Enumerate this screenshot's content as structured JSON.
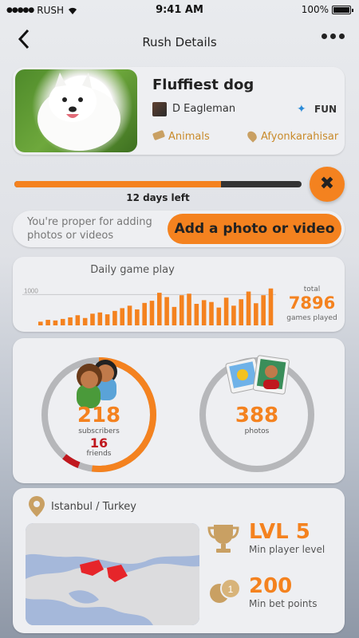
{
  "status_bar": {
    "carrier": "RUSH",
    "time": "9:41 AM",
    "battery": "100%"
  },
  "nav": {
    "title": "Rush Details"
  },
  "rush": {
    "title": "Fluffiest dog",
    "author": "D Eagleman",
    "mood": "FUN",
    "category": "Animals",
    "location": "Afyonkarahisar"
  },
  "progress": {
    "label": "12 days left",
    "fraction": 0.72
  },
  "add_media": {
    "hint": "You're proper for adding photos or videos",
    "button": "Add a photo or video"
  },
  "daily_chart": {
    "title": "Daily game play",
    "total_label": "total",
    "total_value": "7896",
    "total_sub": "games played"
  },
  "chart_data": {
    "type": "bar",
    "title": "Daily game play",
    "ytick": "1000",
    "ylim": [
      0,
      1400
    ],
    "values": [
      120,
      180,
      160,
      210,
      260,
      330,
      240,
      380,
      420,
      360,
      470,
      560,
      640,
      520,
      730,
      800,
      1060,
      920,
      600,
      980,
      1030,
      700,
      820,
      760,
      580,
      900,
      640,
      850,
      1100,
      720,
      980,
      1200
    ]
  },
  "stats": {
    "subscribers_value": "218",
    "subscribers_label": "subscribers",
    "friends_value": "16",
    "friends_label": "friends",
    "subscribers_fraction": 0.52,
    "friends_fraction": 0.05,
    "photos_value": "388",
    "photos_label": "photos"
  },
  "place": {
    "city": "Istanbul / Turkey",
    "level_value": "LVL 5",
    "level_label": "Min player level",
    "bet_value": "200",
    "bet_label": "Min bet points"
  },
  "colors": {
    "accent": "#f4821f",
    "friends": "#c0181e",
    "ring_track": "#b6b7ba"
  }
}
